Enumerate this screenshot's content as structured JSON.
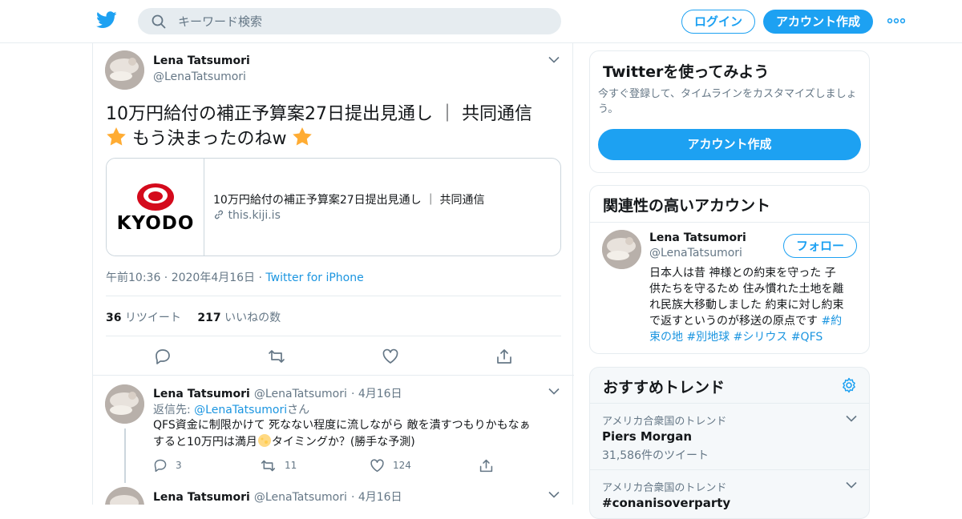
{
  "header": {
    "search_placeholder": "キーワード検索",
    "login_label": "ログイン",
    "signup_label": "アカウント作成"
  },
  "tweet": {
    "name": "Lena Tatsumori",
    "handle": "@LenaTatsumori",
    "text_line1": "10万円給付の補正予算案27日提出見通し ｜ 共同通信",
    "text_line2": "もう決まったのねw",
    "card_logo_text": "KYODO",
    "card_title": "10万円給付の補正予算案27日提出見通し ｜ 共同通信",
    "card_domain": "this.kiji.is",
    "time": "午前10:36 · 2020年4月16日 · ",
    "source": "Twitter for iPhone",
    "retweets": "36",
    "retweets_label": "リツイート",
    "likes": "217",
    "likes_label": "いいねの数"
  },
  "replies": [
    {
      "name": "Lena Tatsumori",
      "handle": "@LenaTatsumori",
      "date": "· 4月16日",
      "reply_to_prefix": "返信先: ",
      "reply_to_handle": "@LenaTatsumori",
      "reply_to_suffix": "さん",
      "text_line1": "QFS資金に制限かけて 死なない程度に流しながら 敵を潰すつもりかもなぁ",
      "text_line2a": "すると10万円は満月",
      "text_line2b": "タイミングか？(勝手な予測)",
      "replies": "3",
      "retweets": "11",
      "likes": "124"
    },
    {
      "name": "Lena Tatsumori",
      "handle": "@LenaTatsumori",
      "date": "· 4月16日"
    }
  ],
  "signup_box": {
    "title": "Twitterを使ってみよう",
    "desc": "今すぐ登録して、タイムラインをカスタマイズしましょう。",
    "button": "アカウント作成"
  },
  "related": {
    "title": "関連性の高いアカウント",
    "name": "Lena Tatsumori",
    "handle": "@LenaTatsumori",
    "follow": "フォロー",
    "bio_line1": "日本人は昔 神様との約束を守った 子",
    "bio_line2": "供たちを守るため 住み慣れた土地を離",
    "bio_line3": "れ民族大移動しました 約束に対し約束",
    "bio_line4a": "で返すというのが移送の原点です ",
    "bio_line4b": "#約",
    "bio_line5a": "束の地",
    "bio_line5b": "#別地球",
    "bio_line5c": "#シリウス",
    "bio_line5d": "#QFS"
  },
  "trends": {
    "title": "おすすめトレンド",
    "items": [
      {
        "context": "アメリカ合衆国のトレンド",
        "name": "Piers Morgan",
        "count": "31,586件のツイート"
      },
      {
        "context": "アメリカ合衆国のトレンド",
        "name": "#conanisoverparty"
      }
    ]
  },
  "colors": {
    "accent": "#1da1f2",
    "link": "#1b95e0",
    "text": "#14171a",
    "muted": "#657786",
    "border": "#e6ecf0",
    "kyodo_red": "#d40a1c"
  }
}
